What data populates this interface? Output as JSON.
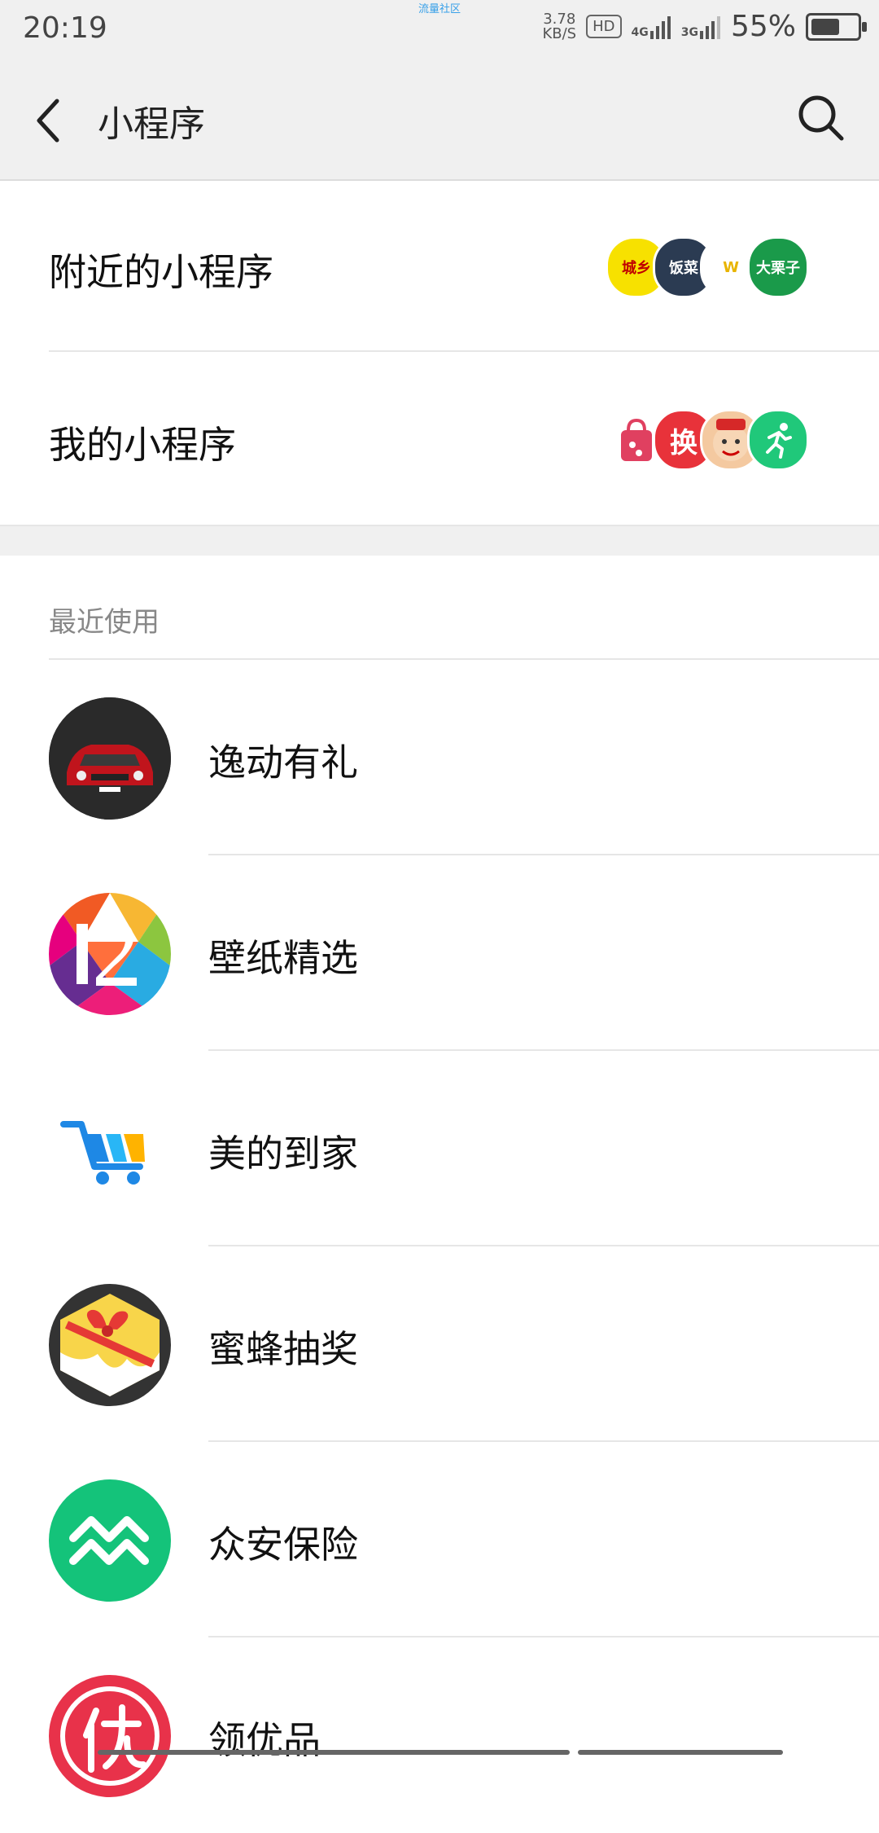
{
  "status_bar": {
    "time": "20:19",
    "center_label": "流量社区",
    "speed_top": "3.78",
    "speed_bottom": "KB/S",
    "hd": "HD",
    "net1": "4G",
    "net2": "3G",
    "battery": "55%",
    "battery_level": 0.55
  },
  "app_bar": {
    "title": "小程序",
    "back_icon": "back-arrow-icon",
    "search_icon": "search-icon"
  },
  "sections": {
    "nearby": {
      "label": "附近的小程序",
      "logos": [
        {
          "text": "城乡",
          "bg": "#f7e100",
          "fg": "#c00000"
        },
        {
          "text": "饭菜",
          "bg": "#2b3b52",
          "fg": "#ffffff"
        },
        {
          "text": "W",
          "bg": "#ffffff",
          "fg": "#e8b400"
        },
        {
          "text": "大栗子",
          "bg": "#1a9a4a",
          "fg": "#ffffff"
        }
      ]
    },
    "mine": {
      "label": "我的小程序",
      "logos": [
        {
          "text": "",
          "bg": "#ffffff",
          "fg": "#e04060"
        },
        {
          "text": "换",
          "bg": "#e8323a",
          "fg": "#ffffff"
        },
        {
          "text": "",
          "bg": "#f4c9a0",
          "fg": "#c00000"
        },
        {
          "text": "",
          "bg": "#20c87a",
          "fg": "#ffffff"
        }
      ]
    }
  },
  "recent": {
    "header": "最近使用",
    "items": [
      {
        "label": "逸动有礼",
        "icon": "car-icon"
      },
      {
        "label": "壁纸精选",
        "icon": "wallpaper-12-icon"
      },
      {
        "label": "美的到家",
        "icon": "shopping-cart-icon"
      },
      {
        "label": "蜜蜂抽奖",
        "icon": "gift-box-icon"
      },
      {
        "label": "众安保险",
        "icon": "zhongan-wave-icon"
      },
      {
        "label": "领优品",
        "icon": "you-badge-icon"
      }
    ]
  },
  "colors": {
    "bar_bg": "#f0f0f0",
    "divider": "#e6e6e6",
    "zhongan_green": "#14c37a",
    "you_red": "#e8324a"
  }
}
